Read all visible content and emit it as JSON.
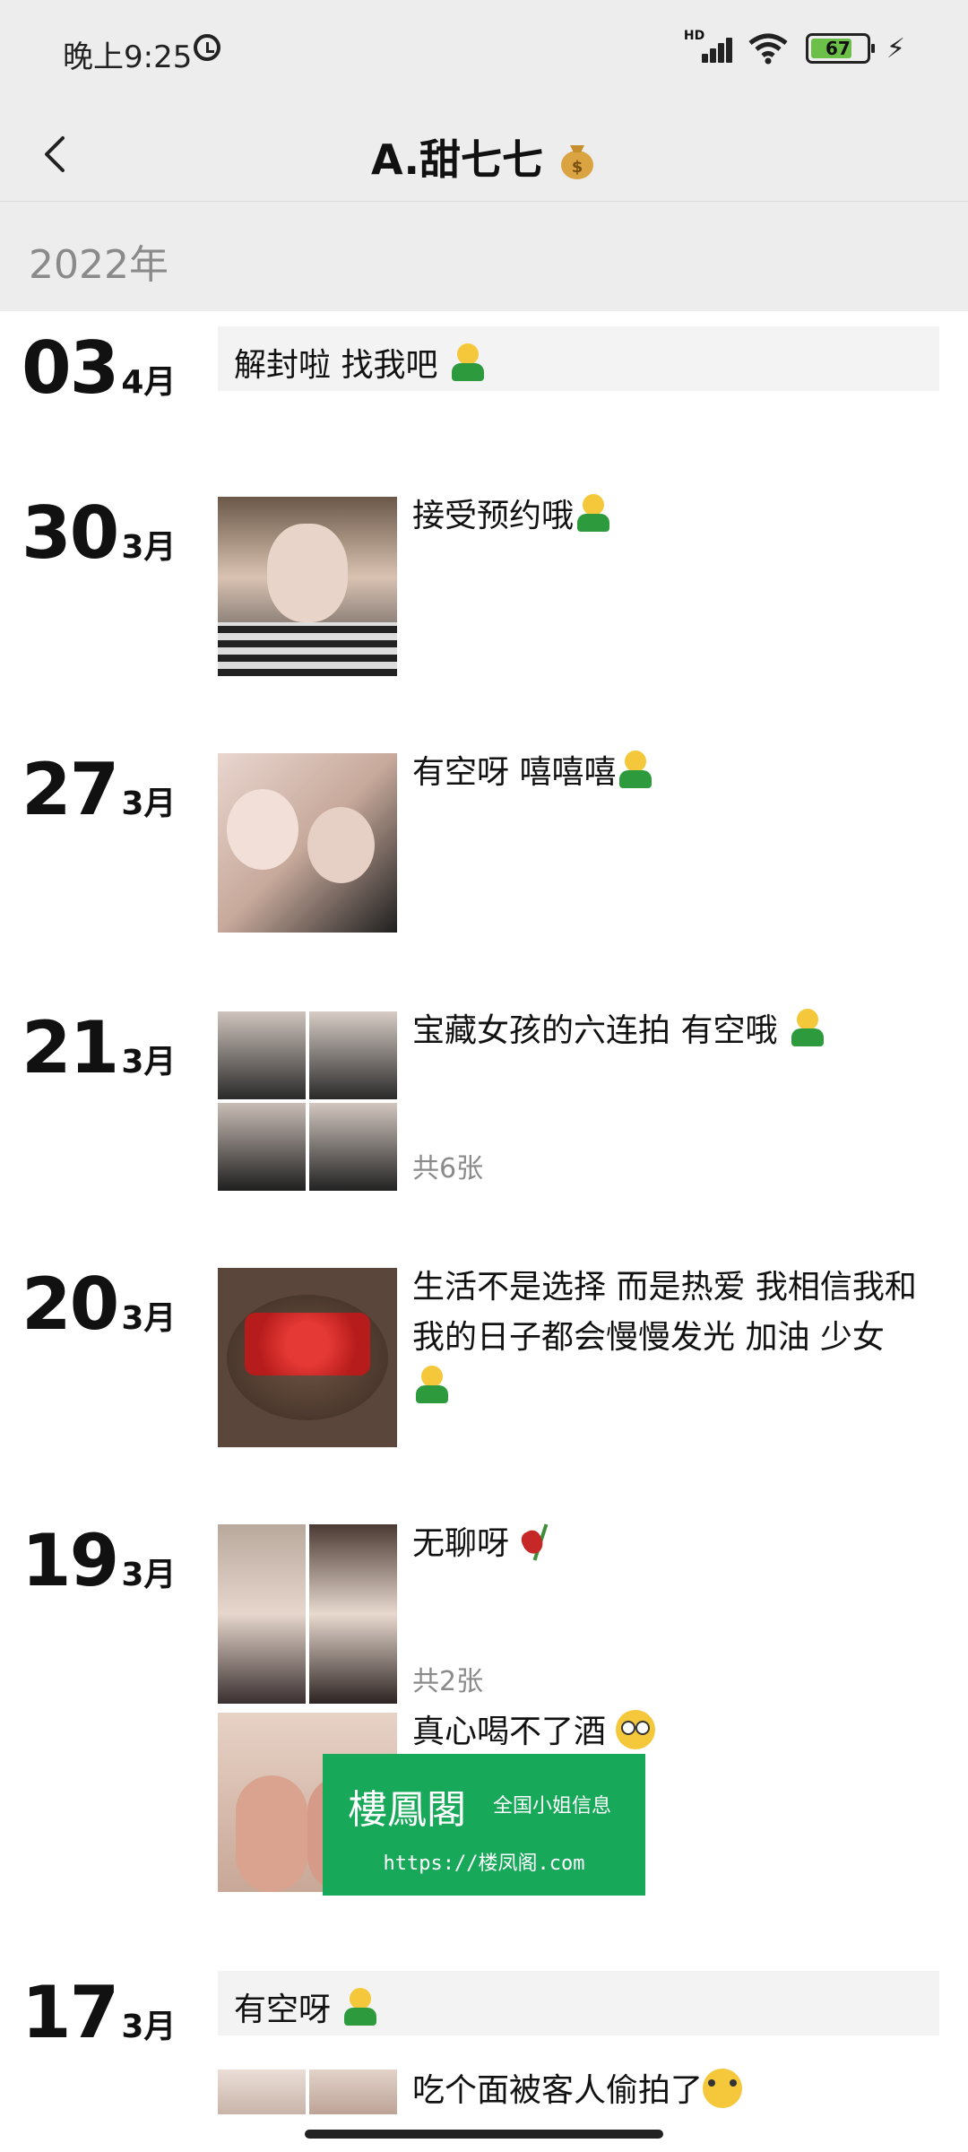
{
  "status": {
    "time": "晚上9:25",
    "network": "HD",
    "battery": "67"
  },
  "header": {
    "title": "A.甜七七"
  },
  "year": "2022年",
  "entries": [
    {
      "day": "03",
      "month": "4月",
      "text": "解封啦 找我吧"
    },
    {
      "day": "30",
      "month": "3月",
      "caption": "接受预约哦"
    },
    {
      "day": "27",
      "month": "3月",
      "caption": "有空呀 嘻嘻嘻"
    },
    {
      "day": "21",
      "month": "3月",
      "caption": "宝藏女孩的六连拍 有空哦 ",
      "count": "共6张"
    },
    {
      "day": "20",
      "month": "3月",
      "caption": "生活不是选择 而是热爱 我相信我和我的日子都会慢慢发光 加油 少女"
    },
    {
      "day": "19",
      "month": "3月",
      "caption": "无聊呀 ",
      "count": "共2张",
      "caption2": "真心喝不了酒 "
    },
    {
      "day": "17",
      "month": "3月",
      "text": "有空呀 ",
      "caption": "吃个面被客人偷拍了"
    }
  ],
  "watermark": {
    "title": "樓鳳閣",
    "subtitle": "全国小姐信息",
    "url": "https://楼凤阁.com"
  },
  "colors": {
    "bar_bg": "#ededed",
    "watermark_bg": "#17a85a"
  },
  "icons": {
    "back": "chevron-left-icon",
    "title_emoji": "money-bag-icon"
  }
}
